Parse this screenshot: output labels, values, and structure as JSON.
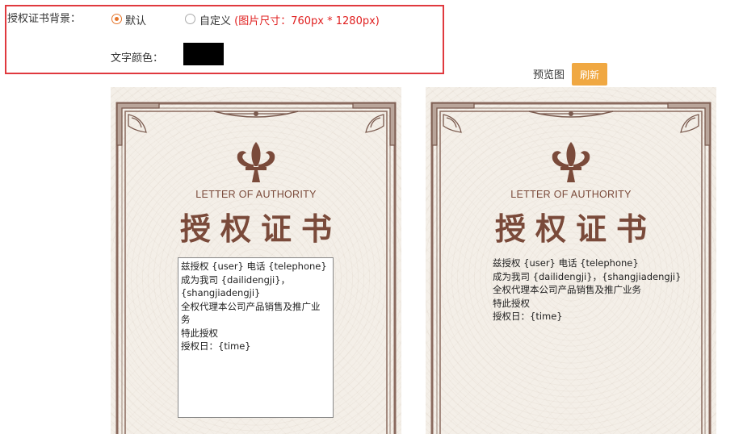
{
  "settings": {
    "background_label": "授权证书背景：",
    "option_default": "默认",
    "option_custom": "自定义",
    "custom_hint": "(图片尺寸：760px * 1280px)",
    "selected_option": "默认",
    "text_color_label": "文字颜色：",
    "text_color_value": "#000000"
  },
  "preview": {
    "label": "预览图",
    "refresh_button": "刷新"
  },
  "certificate": {
    "subtitle": "LETTER OF AUTHORITY",
    "title": "授权证书",
    "accent_color": "#7a4a3a"
  },
  "editor_lines": [
    "兹授权 {user} 电话 {telephone}",
    "成为我司 {dailidengji}，",
    "{shangjiadengji}",
    "全权代理本公司产品销售及推广业",
    "务",
    "特此授权",
    "授权日：{time}"
  ],
  "preview_lines": [
    "兹授权 {user} 电话 {telephone}",
    "成为我司 {dailidengji}，{shangjiadengji}",
    "全权代理本公司产品销售及推广业务",
    "特此授权",
    "授权日：{time}"
  ]
}
